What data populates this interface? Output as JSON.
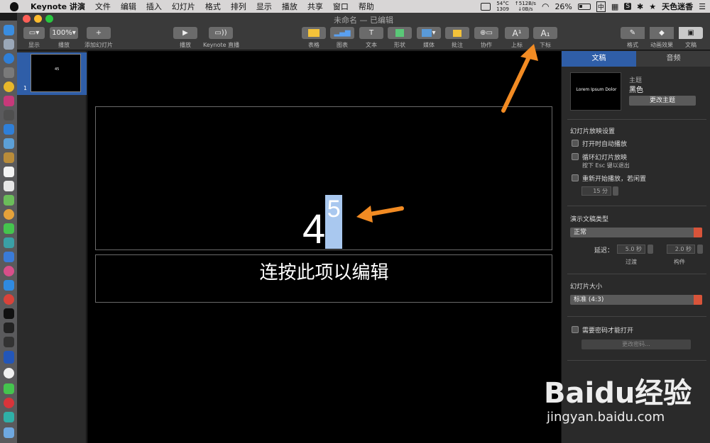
{
  "menubar": {
    "app_name": "Keynote 讲演",
    "items": [
      "文件",
      "编辑",
      "插入",
      "幻灯片",
      "格式",
      "排列",
      "显示",
      "播放",
      "共享",
      "窗口",
      "帮助"
    ],
    "temp": "54°C",
    "fan": "1309",
    "net_up": "↑512B/s",
    "net_down": "↓0B/s",
    "battery": "26%",
    "input_method": "中",
    "user": "天色迷香"
  },
  "window": {
    "title": "未命名 — 已编辑"
  },
  "toolbar": {
    "view_label": "显示",
    "zoom_value": "100%",
    "zoom_label": "播放",
    "add_slide_label": "添加幻灯片",
    "play_label": "播放",
    "keynote_live_label": "Keynote 直播",
    "table_label": "表格",
    "chart_label": "图表",
    "text_label": "文本",
    "shape_label": "形状",
    "media_label": "媒体",
    "comment_label": "批注",
    "collab_label": "协作",
    "superscript_label": "上标",
    "subscript_label": "下标",
    "superscript_glyph": "A¹",
    "subscript_glyph": "A₁",
    "text_glyph": "T",
    "add_glyph": "+",
    "format_label": "格式",
    "animate_label": "动画效果",
    "document_label": "文稿"
  },
  "navigator": {
    "slide_number": "1"
  },
  "slide": {
    "big_text_base": "4",
    "big_text_selected": "5",
    "body_hint": "连按此项以编辑"
  },
  "inspector": {
    "tab_document": "文稿",
    "tab_audio": "音频",
    "theme_preview_title": "Lorem Ipsum Dolor",
    "theme_heading": "主题",
    "theme_name": "黑色",
    "change_theme_button": "更改主题",
    "playback_heading": "幻灯片放映设置",
    "autoplay_label": "打开时自动播放",
    "loop_label": "循环幻灯片放映",
    "loop_hint": "按下 Esc 键以退出",
    "restart_label": "重新开始播放，若闲置",
    "idle_value": "15 分",
    "presentation_type_heading": "演示文稿类型",
    "presentation_type_value": "正常",
    "delay_label": "延迟：",
    "transition_value": "5.0 秒",
    "build_value": "2.0 秒",
    "transition_label": "过渡",
    "build_label": "构件",
    "slide_size_heading": "幻灯片大小",
    "slide_size_value": "标准 (4:3)",
    "password_label": "需要密码才能打开",
    "change_password_button": "更改密码..."
  },
  "watermark": {
    "logo": "Baidu经验",
    "url": "jingyan.baidu.com"
  },
  "colors": {
    "accent_blue": "#2f5ea8",
    "arrow_orange": "#f28b23",
    "selection": "#a9c8ef"
  }
}
